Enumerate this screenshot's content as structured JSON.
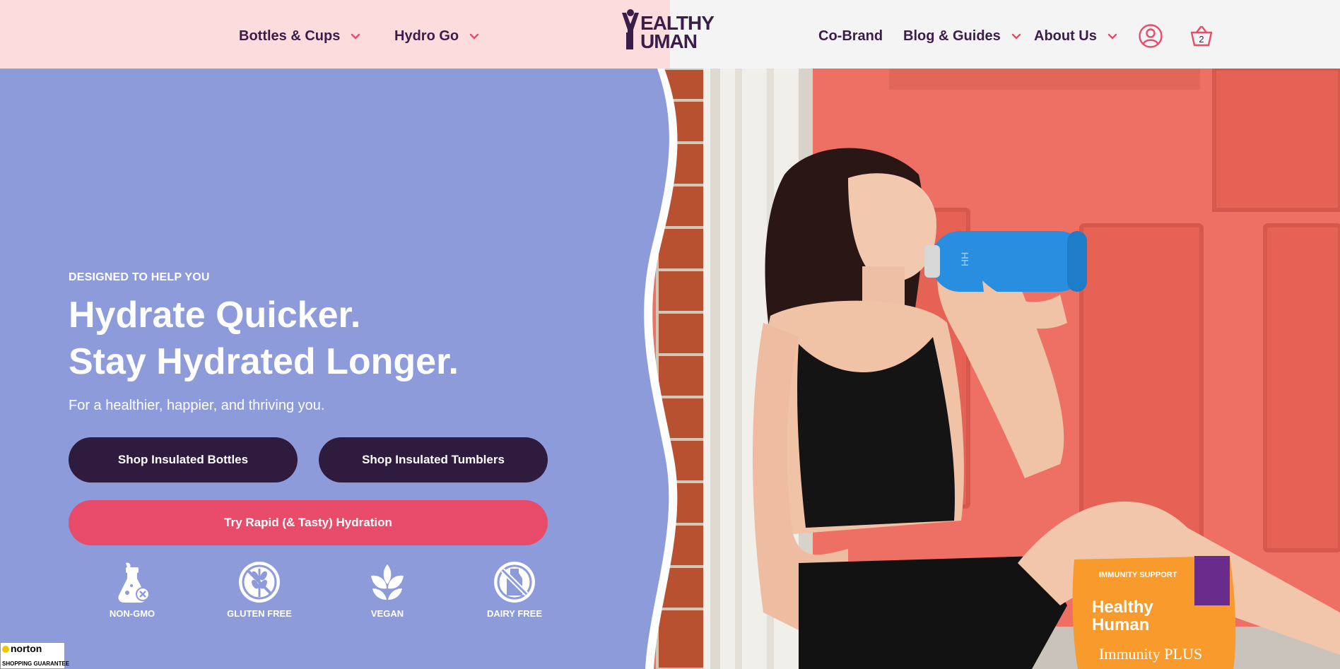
{
  "header": {
    "nav_left": [
      {
        "label": "Bottles & Cups"
      },
      {
        "label": "Hydro Go"
      }
    ],
    "logo_text": "HEALTHY HUMAN",
    "nav_right": [
      {
        "label": "Co-Brand"
      },
      {
        "label": "Blog & Guides"
      },
      {
        "label": "About Us"
      }
    ],
    "cart_count": "2",
    "icons": [
      "chevron-down-icon",
      "user-icon",
      "cart-basket-icon"
    ]
  },
  "hero": {
    "eyebrow": "DESIGNED TO HELP YOU",
    "headline_line1": "Hydrate Quicker.",
    "headline_line2": "Stay Hydrated Longer.",
    "subtext": "For a healthier, happier, and thriving you.",
    "buttons": {
      "bottles": "Shop Insulated Bottles",
      "tumblers": "Shop Insulated Tumblers",
      "hydration": "Try Rapid (& Tasty) Hydration"
    },
    "badges": [
      {
        "label": "NON-GMO",
        "icon": "flask-x-icon"
      },
      {
        "label": "GLUTEN FREE",
        "icon": "no-wheat-icon"
      },
      {
        "label": "VEGAN",
        "icon": "leaf-sprout-icon"
      },
      {
        "label": "DAIRY FREE",
        "icon": "no-milk-icon"
      }
    ]
  },
  "norton": {
    "brand": "norton",
    "caption": "SHOPPING GUARANTEE"
  },
  "colors": {
    "header_pink": "#fcdcdc",
    "hero_blue": "#8d9bdb",
    "brand_purple": "#3a1d49",
    "button_dark": "#2f1b3e",
    "button_pink": "#e94b6b",
    "door_coral": "#ec7266"
  }
}
